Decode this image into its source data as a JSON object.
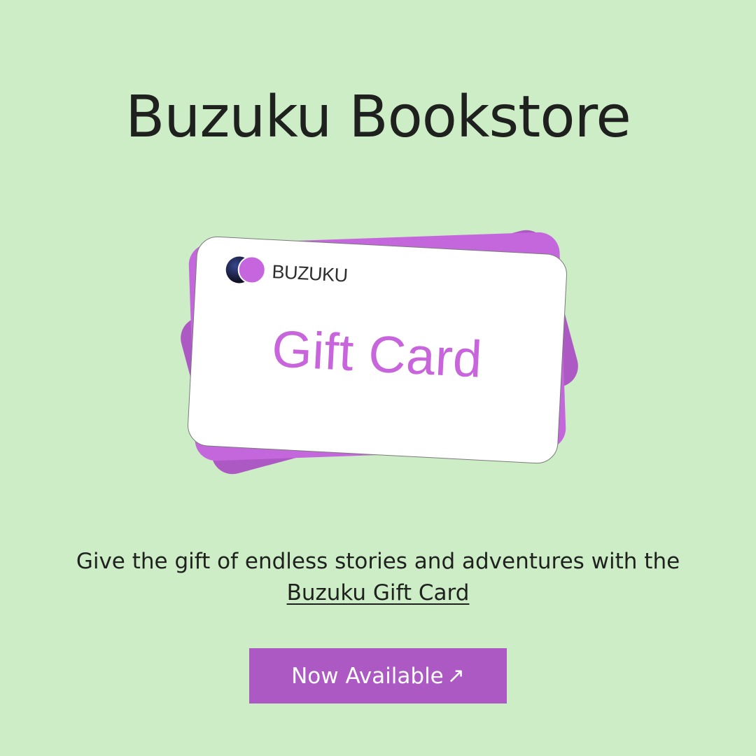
{
  "header": {
    "title": "Buzuku Bookstore"
  },
  "gift_card": {
    "brand": "BUZUKU",
    "title": "Gift Card",
    "logo_icon": "brand-circles-icon",
    "colors": {
      "accent": "#c865dc",
      "back_card": "#ad59c4",
      "middle_card": "#c467dc"
    }
  },
  "promo": {
    "text": "Give the gift of endless stories and adventures with the",
    "link_text": "Buzuku Gift Card"
  },
  "cta": {
    "label": "Now Available",
    "icon": "arrow-up-right-icon",
    "arrow": "↗",
    "color": "#ad59c4"
  },
  "theme": {
    "background": "#cdedc6",
    "text": "#1f211f"
  }
}
